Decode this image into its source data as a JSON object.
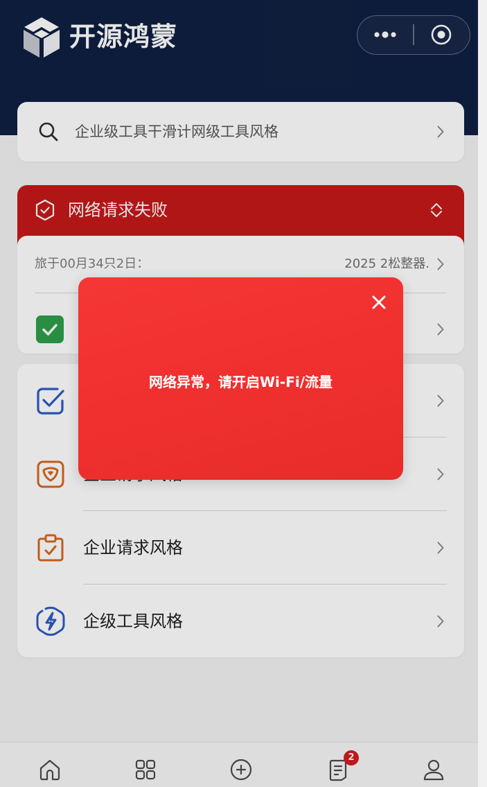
{
  "app": {
    "title": "开源鸿蒙",
    "logo_icon": "app-logo-icon"
  },
  "capsule": {
    "icons": [
      "more-dots-icon",
      "target-circle-icon"
    ]
  },
  "search": {
    "text": "企业级工具干滑计网级工具风格",
    "icon": "search-icon"
  },
  "alert_banner": {
    "text": "网络请求失败",
    "icon": "shield-check-icon",
    "toggle_icon": "expand-collapse-icon"
  },
  "date_card": {
    "label": "旅于00月34只2日：",
    "value": "2025 2松整器.",
    "task_icon": "checkbox-checked-icon"
  },
  "menu_list": {
    "items": [
      {
        "icon": "checkbox-square-icon"
      },
      {
        "icon": "heart-square-icon",
        "label": "企业请求风格"
      },
      {
        "icon": "clipboard-check-icon",
        "label": "企业请求风格"
      },
      {
        "icon": "phone-bolt-icon",
        "label": "企级工具风格"
      }
    ]
  },
  "tabbar": {
    "items": [
      {
        "icon": "home-icon"
      },
      {
        "icon": "grid-icon"
      },
      {
        "icon": "add-circle-icon"
      },
      {
        "icon": "document-icon",
        "badge": "2"
      },
      {
        "icon": "user-icon"
      }
    ]
  },
  "modal": {
    "message": "网络异常，请开启Wi-Fi/流量",
    "close_icon": "close-icon"
  },
  "colors": {
    "header_bg": "#0f2041",
    "alert_red": "#c61919",
    "modal_red": "#f0302e",
    "icon_blue": "#2d5bc4",
    "icon_orange": "#d9661e",
    "check_green": "#2e9e4a",
    "badge_red": "#d41c1c"
  }
}
